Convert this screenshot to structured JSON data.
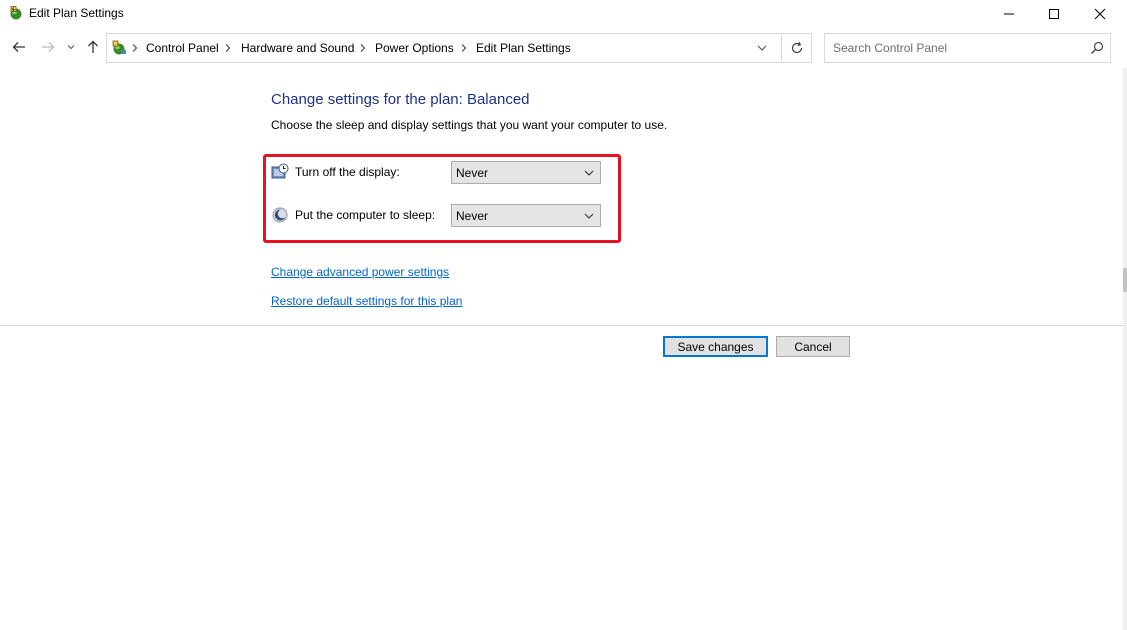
{
  "window": {
    "title": "Edit Plan Settings",
    "icon": "power-options-icon"
  },
  "nav": {
    "breadcrumbs": [
      "Control Panel",
      "Hardware and Sound",
      "Power Options",
      "Edit Plan Settings"
    ],
    "search_placeholder": "Search Control Panel"
  },
  "main": {
    "heading": "Change settings for the plan: Balanced",
    "subheading": "Choose the sleep and display settings that you want your computer to use.",
    "settings": [
      {
        "label": "Turn off the display:",
        "value": "Never",
        "icon": "display-timer-icon"
      },
      {
        "label": "Put the computer to sleep:",
        "value": "Never",
        "icon": "sleep-moon-icon"
      }
    ],
    "links": {
      "advanced": "Change advanced power settings",
      "restore": "Restore default settings for this plan"
    },
    "buttons": {
      "save": "Save changes",
      "cancel": "Cancel"
    }
  },
  "colors": {
    "heading": "#1e3287",
    "link": "#0066cc",
    "highlight": "#e81123",
    "primary_border": "#0078d7"
  }
}
